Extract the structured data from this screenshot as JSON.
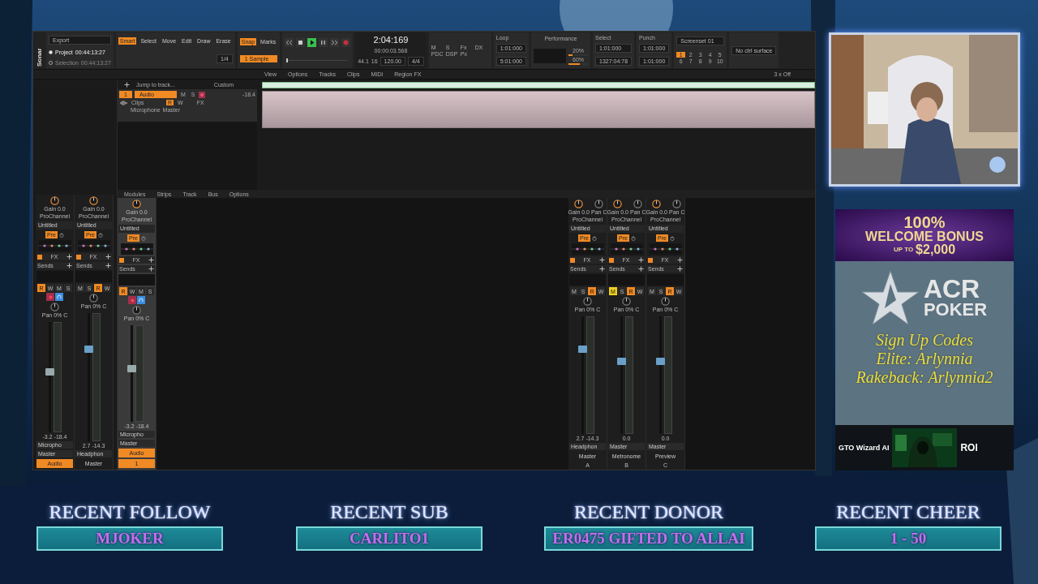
{
  "daw": {
    "logo": "Sonar",
    "export": "Export",
    "positions": [
      {
        "label": "Project",
        "value": "00:44:13:27",
        "selected": true
      },
      {
        "label": "Selection",
        "value": "00:44:13:27",
        "selected": false
      }
    ],
    "tools": [
      {
        "label": "Smart",
        "selected": true
      },
      {
        "label": "Select",
        "selected": false
      },
      {
        "label": "Move",
        "selected": false
      },
      {
        "label": "Edit",
        "selected": false
      },
      {
        "label": "Draw",
        "selected": false
      },
      {
        "label": "Erase",
        "selected": false
      }
    ],
    "tool_resolution": "1/4",
    "snap": {
      "label": "Snap",
      "on": true,
      "value": "1 Sample",
      "marks": "Marks"
    },
    "transport": {
      "playing": true,
      "recording": false,
      "level": 0,
      "time": "2:04:169",
      "subtime": "00:00:03.568",
      "rate": "44.1",
      "bits": "16",
      "tempo": "120.00",
      "meter": "4/4"
    },
    "mix_buttons": [
      "M",
      "S",
      "Fx",
      "DX",
      "PDC",
      "DSP",
      "Px"
    ],
    "loop": {
      "title": "Loop",
      "start": "1:01:000",
      "end": "5:01:000"
    },
    "performance": {
      "title": "Performance",
      "meters": [
        {
          "reading": "20%",
          "level": 0.2
        },
        {
          "reading": "60%",
          "level": 0.6
        }
      ]
    },
    "select": {
      "title": "Select",
      "start": "1:01:000",
      "end": "1327:04:78"
    },
    "punch": {
      "title": "Punch",
      "start": "1:01:000",
      "end": "1:01:000"
    },
    "screenset": {
      "title": "Screenset 01",
      "slots": [
        {
          "label": "1",
          "selected": true
        },
        {
          "label": "2",
          "selected": false
        },
        {
          "label": "3",
          "selected": false
        },
        {
          "label": "4",
          "selected": false
        },
        {
          "label": "5",
          "selected": false
        },
        {
          "label": "6",
          "selected": false
        },
        {
          "label": "7",
          "selected": false
        },
        {
          "label": "8",
          "selected": false
        },
        {
          "label": "9",
          "selected": false
        },
        {
          "label": "10",
          "selected": false
        }
      ]
    },
    "control_surface": "No ctrl surface",
    "menu": [
      "View",
      "Options",
      "Tracks",
      "Clips",
      "MIDI",
      "Region FX"
    ],
    "jump": "Jump to track...",
    "view_preset": "Custom",
    "zoom_off": "3 x Off",
    "track": {
      "number": "1",
      "name": "Audio",
      "volume": "-18.4",
      "lane": "Clips",
      "input": "Microphone",
      "output": "Master",
      "fx": "FX",
      "armed": true,
      "buttons": [
        {
          "kind": "mute",
          "label": "M",
          "lit": false
        },
        {
          "kind": "solo",
          "label": "S",
          "lit": false
        },
        {
          "kind": "read",
          "label": "R",
          "lit": true
        },
        {
          "kind": "write",
          "label": "W",
          "lit": false
        }
      ]
    },
    "console_menu": [
      "Modules",
      "Strips",
      "Track",
      "Bus",
      "Options"
    ],
    "strips": [
      {
        "gain": "Gain 0.0",
        "prochannel": "ProChannel",
        "preset": "Untitled",
        "pre": "Pre",
        "fx": "FX",
        "sends": "Sends",
        "buttons": [
          {
            "kind": "arm",
            "label": "R",
            "lit": true
          },
          {
            "kind": "write",
            "label": "W",
            "lit": false
          },
          {
            "kind": "mute",
            "label": "M",
            "lit": false
          },
          {
            "kind": "solo",
            "label": "S",
            "lit": false
          },
          {
            "kind": "record",
            "lit": true
          },
          {
            "kind": "monitor",
            "lit": true
          }
        ],
        "pan_reading": "Pan 0% C",
        "level": 0.55,
        "readouts": [
          "-3.2",
          "-18.4"
        ],
        "input": "Micropho",
        "output": "Master",
        "name": "Audio",
        "selected": true
      },
      {
        "gain": "Gain 0.0",
        "prochannel": "ProChannel",
        "preset": "Untitled",
        "pre": "Pre",
        "fx": "FX",
        "sends": "Sends",
        "buttons": [
          {
            "kind": "mute",
            "label": "M",
            "lit": false
          },
          {
            "kind": "solo",
            "label": "S",
            "lit": false
          },
          {
            "kind": "arm",
            "label": "R",
            "lit": true
          },
          {
            "kind": "write",
            "label": "W",
            "lit": false
          }
        ],
        "pan_reading": "Pan 0% C",
        "level": 0.72,
        "readouts": [
          "2.7",
          "-14.3"
        ],
        "output": "Headphon",
        "name": "Master",
        "selected": false
      }
    ],
    "inspector": {
      "gain": "Gain 0.0",
      "prochannel": "ProChannel",
      "preset": "Untitled",
      "pre": "Pre",
      "fx": "FX",
      "sends": "Sends",
      "buttons": [
        {
          "kind": "arm",
          "label": "R",
          "lit": true
        },
        {
          "kind": "write",
          "label": "W",
          "lit": false
        },
        {
          "kind": "mute",
          "label": "M",
          "lit": false
        },
        {
          "kind": "solo",
          "label": "S",
          "lit": false
        },
        {
          "kind": "record",
          "lit": true
        },
        {
          "kind": "monitor",
          "lit": true
        }
      ],
      "pan_reading": "Pan 0% C",
      "level": 0.55,
      "readouts": [
        "-3.2",
        "-18.4"
      ],
      "input": "Micropho",
      "output": "Master",
      "name": "Audio",
      "number": "1",
      "selected": true
    },
    "buses": [
      {
        "gain": "Gain 0.0",
        "pan": "Pan C",
        "prochannel": "ProChannel",
        "preset": "Untitled",
        "pre": "Pre",
        "fx": "FX",
        "sends": "Sends",
        "buttons": [
          {
            "kind": "mute",
            "label": "M",
            "lit": false
          },
          {
            "kind": "solo",
            "label": "S",
            "lit": false
          },
          {
            "kind": "arm",
            "label": "R",
            "lit": true
          },
          {
            "kind": "write",
            "label": "W",
            "lit": false
          }
        ],
        "pan_reading": "Pan 0% C",
        "level": 0.72,
        "readouts": [
          "2.7",
          "-14.3"
        ],
        "output": "Headphon",
        "name": "Master",
        "letter": "A",
        "selected": false
      },
      {
        "gain": "Gain 0.0",
        "pan": "Pan C",
        "prochannel": "ProChannel",
        "preset": "Untitled",
        "pre": "Pre",
        "fx": "FX",
        "sends": "Sends",
        "buttons": [
          {
            "kind": "mute",
            "label": "M",
            "lit": true
          },
          {
            "kind": "solo",
            "label": "S",
            "lit": false
          },
          {
            "kind": "arm",
            "label": "R",
            "lit": true
          },
          {
            "kind": "write",
            "label": "W",
            "lit": false
          }
        ],
        "pan_reading": "Pan 0% C",
        "level": 0.62,
        "readouts": [
          "0.0"
        ],
        "output": "Master",
        "name": "Metronome",
        "letter": "B",
        "selected": false
      },
      {
        "gain": "Gain 0.0",
        "pan": "Pan C",
        "prochannel": "ProChannel",
        "preset": "Untitled",
        "pre": "Pre",
        "fx": "FX",
        "sends": "Sends",
        "buttons": [
          {
            "kind": "mute",
            "label": "M",
            "lit": false
          },
          {
            "kind": "solo",
            "label": "S",
            "lit": false
          },
          {
            "kind": "arm",
            "label": "R",
            "lit": true
          },
          {
            "kind": "write",
            "label": "W",
            "lit": false
          }
        ],
        "pan_reading": "Pan 0% C",
        "level": 0.62,
        "readouts": [
          "0.0"
        ],
        "output": "Master",
        "name": "Preview",
        "letter": "C",
        "selected": false
      }
    ]
  },
  "ad": {
    "headline": "100%",
    "subhead": "WELCOME BONUS",
    "upto": "UP TO",
    "amount": "$2,000",
    "brand": "ACR",
    "brand_sub": "POKER",
    "codes": [
      "Sign Up Codes",
      "Elite: Arlynnia",
      "Rakeback: Arlynnia2"
    ],
    "footer_brand": "GTO Wizard AI",
    "footer_badge": "ROI"
  },
  "alerts": [
    {
      "title": "RECENT FOLLOW",
      "name": "MJOKER"
    },
    {
      "title": "RECENT SUB",
      "name": "CARLITO1"
    },
    {
      "title": "RECENT DONOR",
      "name": "ER0475 GIFTED TO ALLAI"
    },
    {
      "title": "RECENT CHEER",
      "name": "1 - 50"
    }
  ]
}
